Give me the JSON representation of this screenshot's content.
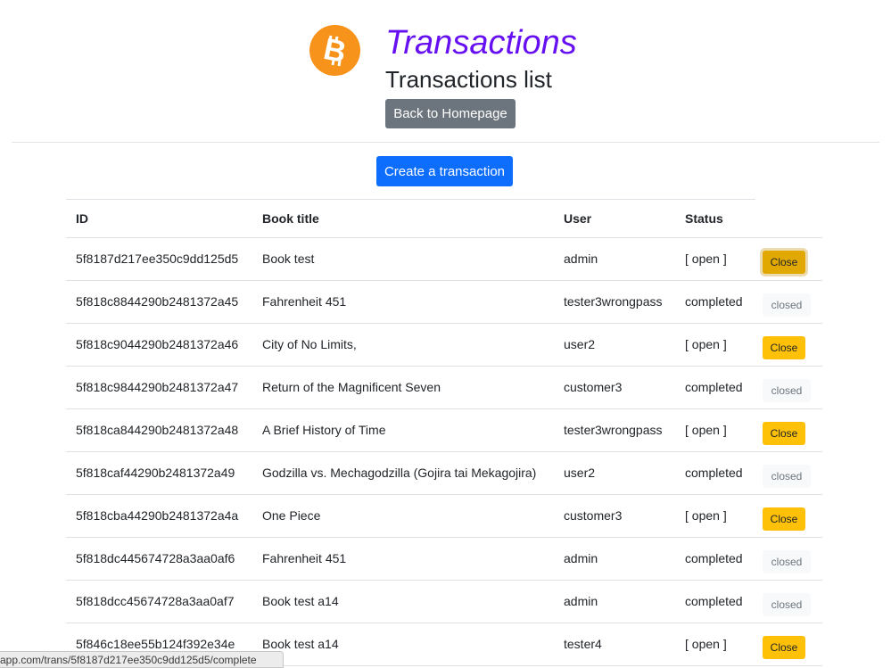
{
  "header": {
    "logo_icon": "bitcoin-icon",
    "logo_color": "#f7931a",
    "title": "Transactions",
    "title_color": "#6610f2",
    "subtitle": "Transactions list",
    "back_label": "Back to Homepage"
  },
  "actions": {
    "create_label": "Create a transaction"
  },
  "table": {
    "columns": [
      "ID",
      "Book title",
      "User",
      "Status"
    ],
    "rows": [
      {
        "id": "5f8187d217ee350c9dd125d5",
        "book": "Book test",
        "user": "admin",
        "status": "[ open ]",
        "action": "Close"
      },
      {
        "id": "5f818c8844290b2481372a45",
        "book": "Fahrenheit 451",
        "user": "tester3wrongpass",
        "status": "completed",
        "action": "closed"
      },
      {
        "id": "5f818c9044290b2481372a46",
        "book": "City of No Limits,",
        "user": "user2",
        "status": "[ open ]",
        "action": "Close"
      },
      {
        "id": "5f818c9844290b2481372a47",
        "book": "Return of the Magnificent Seven",
        "user": "customer3",
        "status": "completed",
        "action": "closed"
      },
      {
        "id": "5f818ca844290b2481372a48",
        "book": "A Brief History of Time",
        "user": "tester3wrongpass",
        "status": "[ open ]",
        "action": "Close"
      },
      {
        "id": "5f818caf44290b2481372a49",
        "book": "Godzilla vs. Mechagodzilla (Gojira tai Mekagojira)",
        "user": "user2",
        "status": "completed",
        "action": "closed"
      },
      {
        "id": "5f818cba44290b2481372a4a",
        "book": "One Piece",
        "user": "customer3",
        "status": "[ open ]",
        "action": "Close"
      },
      {
        "id": "5f818dc445674728a3aa0af6",
        "book": "Fahrenheit 451",
        "user": "admin",
        "status": "completed",
        "action": "closed"
      },
      {
        "id": "5f818dcc45674728a3aa0af7",
        "book": "Book test a14",
        "user": "admin",
        "status": "completed",
        "action": "closed"
      },
      {
        "id": "5f846c18ee55b124f392e34e",
        "book": "Book test a14",
        "user": "tester4",
        "status": "[ open ]",
        "action": "Close"
      }
    ]
  },
  "statusbar": {
    "url": "app.com/trans/5f8187d217ee350c9dd125d5/complete"
  },
  "colors": {
    "primary": "#0d6efd",
    "secondary": "#6c757d",
    "warning": "#ffc107"
  }
}
